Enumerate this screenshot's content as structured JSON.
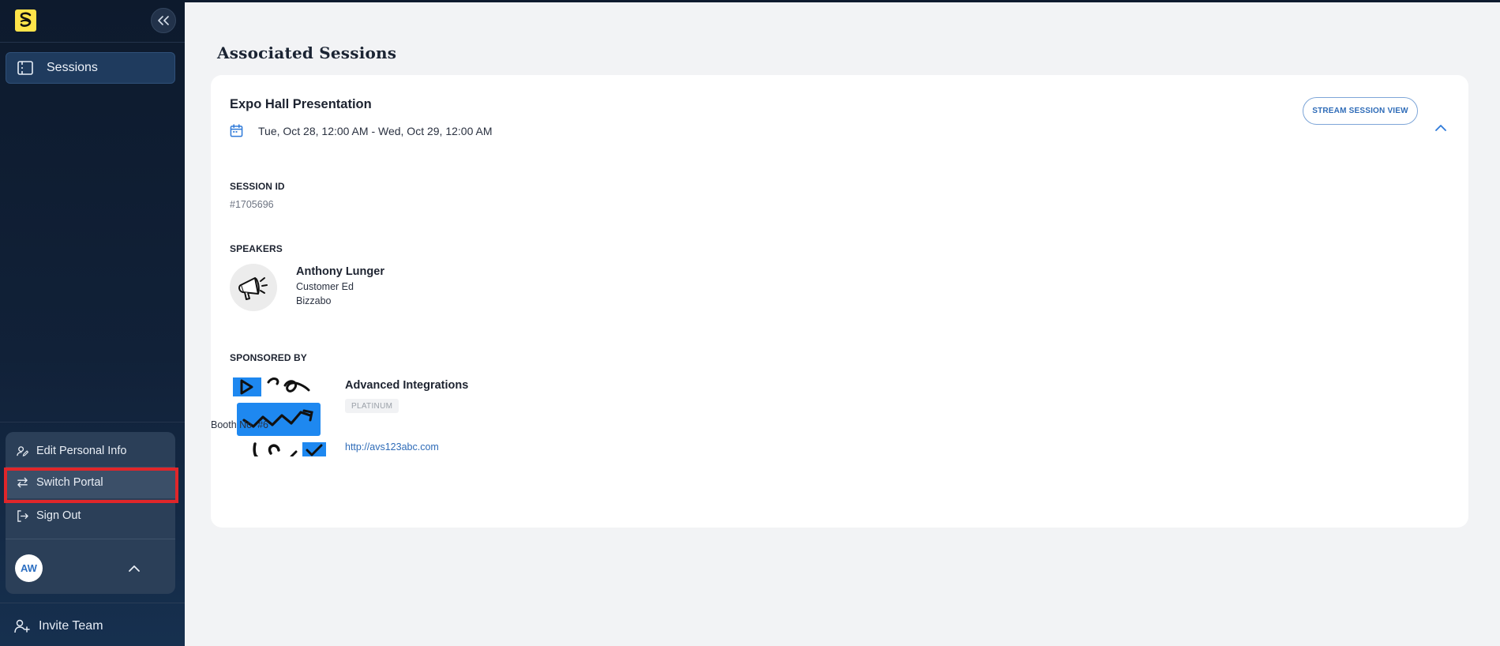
{
  "sidebar": {
    "logo_icon": "brand-logo-icon",
    "collapse_icon": "double-chevron-left-icon",
    "nav": [
      {
        "label": "Sessions",
        "icon": "ticket-icon"
      }
    ],
    "menu": {
      "edit_personal_info": "Edit Personal Info",
      "switch_portal": "Switch Portal",
      "sign_out": "Sign Out"
    },
    "user": {
      "initials": "AW"
    },
    "invite_team": "Invite Team"
  },
  "main": {
    "page_title": "Associated Sessions",
    "session": {
      "title": "Expo Hall Presentation",
      "date_range": "Tue, Oct 28, 12:00 AM - Wed, Oct 29, 12:00 AM",
      "stream_button": "STREAM SESSION VIEW",
      "session_id_label": "SESSION ID",
      "session_id": "#1705696",
      "speakers_label": "SPEAKERS",
      "speakers": [
        {
          "name": "Anthony Lunger",
          "title": "Customer Ed",
          "company": "Bizzabo"
        }
      ],
      "sponsored_by_label": "SPONSORED BY",
      "sponsor": {
        "name": "Advanced Integrations",
        "tier": "PLATINUM",
        "booth": "Booth No. #6",
        "url": "http://avs123abc.com"
      }
    }
  },
  "colors": {
    "sidebar_bg": "#112138",
    "accent_blue": "#2f6cb8",
    "highlight_red": "#e0262a",
    "logo_yellow": "#ffe44a"
  }
}
